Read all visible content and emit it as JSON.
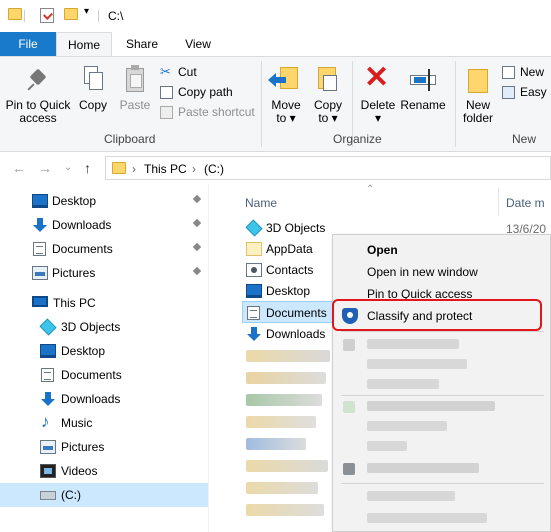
{
  "window": {
    "title": "C:\\"
  },
  "ribbon_tabs": [
    "File",
    "Home",
    "Share",
    "View"
  ],
  "ribbon": {
    "clipboard": {
      "pin_label_1": "Pin to Quick",
      "pin_label_2": "access",
      "copy": "Copy",
      "paste": "Paste",
      "cut": "Cut",
      "copy_path": "Copy path",
      "paste_shortcut": "Paste shortcut",
      "group": "Clipboard"
    },
    "organize": {
      "move_to_1": "Move",
      "move_to_2": "to ▾",
      "copy_to_1": "Copy",
      "copy_to_2": "to ▾",
      "delete_1": "Delete",
      "delete_2": "▾",
      "rename": "Rename",
      "group": "Organize"
    },
    "new": {
      "new_folder_1": "New",
      "new_folder_2": "folder",
      "new_item": "New",
      "easy_access": "Easy",
      "group": "New"
    }
  },
  "address": {
    "crumbs": [
      "This PC",
      "(C:)"
    ],
    "sep": "›"
  },
  "nav_pane": {
    "quick_access": [
      {
        "label": "Desktop",
        "icon": "desktop-icon"
      },
      {
        "label": "Downloads",
        "icon": "downloads-icon"
      },
      {
        "label": "Documents",
        "icon": "documents-icon"
      },
      {
        "label": "Pictures",
        "icon": "pictures-icon"
      }
    ],
    "this_pc": "This PC",
    "this_pc_items": [
      {
        "label": "3D Objects",
        "icon": "3d-objects-icon"
      },
      {
        "label": "Desktop",
        "icon": "desktop-icon"
      },
      {
        "label": "Documents",
        "icon": "documents-icon"
      },
      {
        "label": "Downloads",
        "icon": "downloads-icon"
      },
      {
        "label": "Music",
        "icon": "music-icon"
      },
      {
        "label": "Pictures",
        "icon": "pictures-icon"
      },
      {
        "label": "Videos",
        "icon": "videos-icon"
      },
      {
        "label": "(C:)",
        "icon": "drive-icon"
      }
    ]
  },
  "file_list": {
    "col_name": "Name",
    "col_date": "Date m",
    "date_first": "13/6/20",
    "items": [
      {
        "label": "3D Objects"
      },
      {
        "label": "AppData"
      },
      {
        "label": "Contacts"
      },
      {
        "label": "Desktop"
      },
      {
        "label": "Documents"
      },
      {
        "label": "Downloads"
      }
    ]
  },
  "context_menu": {
    "open": "Open",
    "open_new_window": "Open in new window",
    "pin_quick_access": "Pin to Quick access",
    "classify_protect": "Classify and protect"
  },
  "colors": {
    "accent": "#1979ca",
    "highlight_border": "#e0161b",
    "selection": "#cce8ff"
  }
}
